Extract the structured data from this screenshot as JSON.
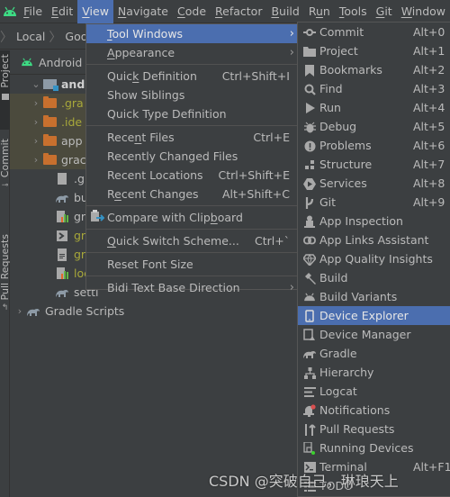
{
  "menubar": {
    "items": [
      {
        "label": "File",
        "mnemonic": "F"
      },
      {
        "label": "Edit",
        "mnemonic": "E"
      },
      {
        "label": "View",
        "mnemonic": "V",
        "active": true
      },
      {
        "label": "Navigate",
        "mnemonic": "N"
      },
      {
        "label": "Code",
        "mnemonic": "C"
      },
      {
        "label": "Refactor",
        "mnemonic": "R"
      },
      {
        "label": "Build",
        "mnemonic": "B"
      },
      {
        "label": "Run",
        "mnemonic": "u"
      },
      {
        "label": "Tools",
        "mnemonic": "T"
      },
      {
        "label": "Git",
        "mnemonic": "G"
      },
      {
        "label": "Window",
        "mnemonic": "W"
      }
    ]
  },
  "navbar": {
    "crumbs": [
      "Local",
      "Googl"
    ]
  },
  "stripe": {
    "tabs": [
      "Project",
      "Commit",
      "Pull Requests"
    ]
  },
  "project": {
    "view_label": "Android",
    "tree": [
      {
        "label": "androi",
        "type": "module",
        "arrow": "down",
        "indent": 0,
        "bold": true
      },
      {
        "label": ".gra",
        "type": "folder",
        "arrow": "right",
        "indent": 1,
        "ignored": true
      },
      {
        "label": ".ide",
        "type": "folder",
        "arrow": "right",
        "indent": 1,
        "ignored": true
      },
      {
        "label": "app",
        "type": "folder",
        "arrow": "right",
        "indent": 1
      },
      {
        "label": "grac",
        "type": "folder",
        "arrow": "right",
        "indent": 1
      },
      {
        "label": ".giti",
        "type": "gitignore",
        "indent": 2
      },
      {
        "label": "buil",
        "type": "gradle",
        "indent": 2
      },
      {
        "label": "grac",
        "type": "properties",
        "indent": 2
      },
      {
        "label": "grac",
        "type": "script",
        "indent": 2,
        "ignored": true
      },
      {
        "label": "grac",
        "type": "text",
        "indent": 2,
        "ignored": true
      },
      {
        "label": "loca",
        "type": "properties",
        "indent": 2,
        "ignored": true
      },
      {
        "label": "setti",
        "type": "gradle",
        "indent": 2
      },
      {
        "label": "Gradle Scripts",
        "type": "gradle",
        "arrow": "right",
        "indent": 0
      }
    ]
  },
  "view_menu": {
    "items": [
      {
        "label": "Tool Windows",
        "mnemonic": "T",
        "submenu": true,
        "selected": true
      },
      {
        "label": "Appearance",
        "mnemonic": "A",
        "submenu": true
      },
      {
        "separator": true
      },
      {
        "label": "Quick Definition",
        "mnemonic": "k",
        "shortcut": "Ctrl+Shift+I"
      },
      {
        "label": "Show Siblings"
      },
      {
        "label": "Quick Type Definition"
      },
      {
        "separator": true
      },
      {
        "label": "Recent Files",
        "mnemonic": "n",
        "shortcut": "Ctrl+E"
      },
      {
        "label": "Recently Changed Files"
      },
      {
        "label": "Recent Locations",
        "shortcut": "Ctrl+Shift+E"
      },
      {
        "label": "Recent Changes",
        "mnemonic": "e",
        "shortcut": "Alt+Shift+C"
      },
      {
        "separator": true
      },
      {
        "label": "Compare with Clipboard",
        "mnemonic": "b",
        "icon": "clipboard-compare-icon"
      },
      {
        "separator": true
      },
      {
        "label": "Quick Switch Scheme...",
        "mnemonic": "Q",
        "shortcut": "Ctrl+`"
      },
      {
        "separator": true
      },
      {
        "label": "Reset Font Size"
      },
      {
        "separator": true
      },
      {
        "label": "Bidi Text Base Direction",
        "submenu": true
      }
    ]
  },
  "tool_windows_menu": {
    "items": [
      {
        "label": "Commit",
        "shortcut": "Alt+0",
        "icon": "commit-icon"
      },
      {
        "label": "Project",
        "shortcut": "Alt+1",
        "icon": "folder-icon"
      },
      {
        "label": "Bookmarks",
        "shortcut": "Alt+2",
        "icon": "bookmark-icon"
      },
      {
        "label": "Find",
        "shortcut": "Alt+3",
        "icon": "search-icon"
      },
      {
        "label": "Run",
        "shortcut": "Alt+4",
        "icon": "run-icon"
      },
      {
        "label": "Debug",
        "shortcut": "Alt+5",
        "icon": "bug-icon"
      },
      {
        "label": "Problems",
        "shortcut": "Alt+6",
        "icon": "problems-icon"
      },
      {
        "label": "Structure",
        "shortcut": "Alt+7",
        "icon": "structure-icon"
      },
      {
        "label": "Services",
        "shortcut": "Alt+8",
        "icon": "services-icon"
      },
      {
        "label": "Git",
        "shortcut": "Alt+9",
        "icon": "git-icon"
      },
      {
        "label": "App Inspection",
        "icon": "app-inspection-icon"
      },
      {
        "label": "App Links Assistant",
        "icon": "link-icon"
      },
      {
        "label": "App Quality Insights",
        "icon": "diamond-icon"
      },
      {
        "label": "Build",
        "icon": "hammer-icon"
      },
      {
        "label": "Build Variants",
        "icon": "android-icon"
      },
      {
        "label": "Device Explorer",
        "icon": "phone-icon",
        "selected": true
      },
      {
        "label": "Device Manager",
        "icon": "device-manager-icon"
      },
      {
        "label": "Gradle",
        "icon": "gradle-icon"
      },
      {
        "label": "Hierarchy",
        "icon": "hierarchy-icon"
      },
      {
        "label": "Logcat",
        "icon": "logcat-icon"
      },
      {
        "label": "Notifications",
        "icon": "bell-icon"
      },
      {
        "label": "Pull Requests",
        "icon": "pull-request-icon"
      },
      {
        "label": "Running Devices",
        "icon": "running-devices-icon"
      },
      {
        "label": "Terminal",
        "shortcut": "Alt+F12",
        "icon": "terminal-icon"
      },
      {
        "label": "TODO",
        "icon": "todo-icon"
      }
    ]
  },
  "watermark": "CSDN @突破自己，琳琅天上",
  "colors": {
    "selection": "#4b6eaf",
    "background": "#3c3f41",
    "folder": "#c8702e",
    "ignored_text": "#a8a83a",
    "android_green": "#3ddc84"
  }
}
